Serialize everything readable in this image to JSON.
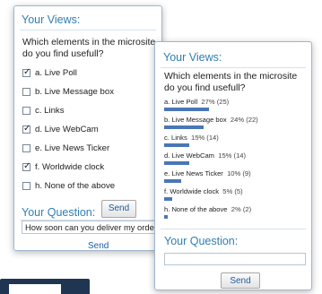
{
  "panel_vote": {
    "heading": "Your Views:",
    "question": "Which elements in the microsite do you find usefull?",
    "options": [
      {
        "label": "a. Live Poll",
        "checked": true
      },
      {
        "label": "b. Live Message box",
        "checked": false
      },
      {
        "label": "c. Links",
        "checked": false
      },
      {
        "label": "d. Live WebCam",
        "checked": true
      },
      {
        "label": "e. Live News Ticker",
        "checked": false
      },
      {
        "label": "f. Worldwide clock",
        "checked": true
      },
      {
        "label": "h. None of the above",
        "checked": false
      }
    ],
    "send_label": "Send",
    "question_heading": "Your Question:",
    "question_value": "How soon can you deliver my order?",
    "question_send_label": "Send"
  },
  "panel_results": {
    "heading": "Your Views:",
    "question": "Which elements in the microsite do you find usefull?",
    "results": [
      {
        "label": "a. Live Poll",
        "pct": "27% (25)",
        "percent": 27
      },
      {
        "label": "b. Live Message box",
        "pct": "24% (22)",
        "percent": 24
      },
      {
        "label": "c. Links",
        "pct": "15% (14)",
        "percent": 15
      },
      {
        "label": "d. Live WebCam",
        "pct": "15% (14)",
        "percent": 15
      },
      {
        "label": "e. Live News Ticker",
        "pct": "10% (9)",
        "percent": 10
      },
      {
        "label": "f. Worldwide clock",
        "pct": "5% (5)",
        "percent": 5
      },
      {
        "label": "h. None of the above",
        "pct": "2% (2)",
        "percent": 2
      }
    ],
    "question_heading": "Your Question:",
    "question_value": "",
    "send_label": "Send"
  },
  "colors": {
    "heading": "#2f7fb3",
    "bar": "#4a76b8",
    "navy": "#1f3552"
  }
}
